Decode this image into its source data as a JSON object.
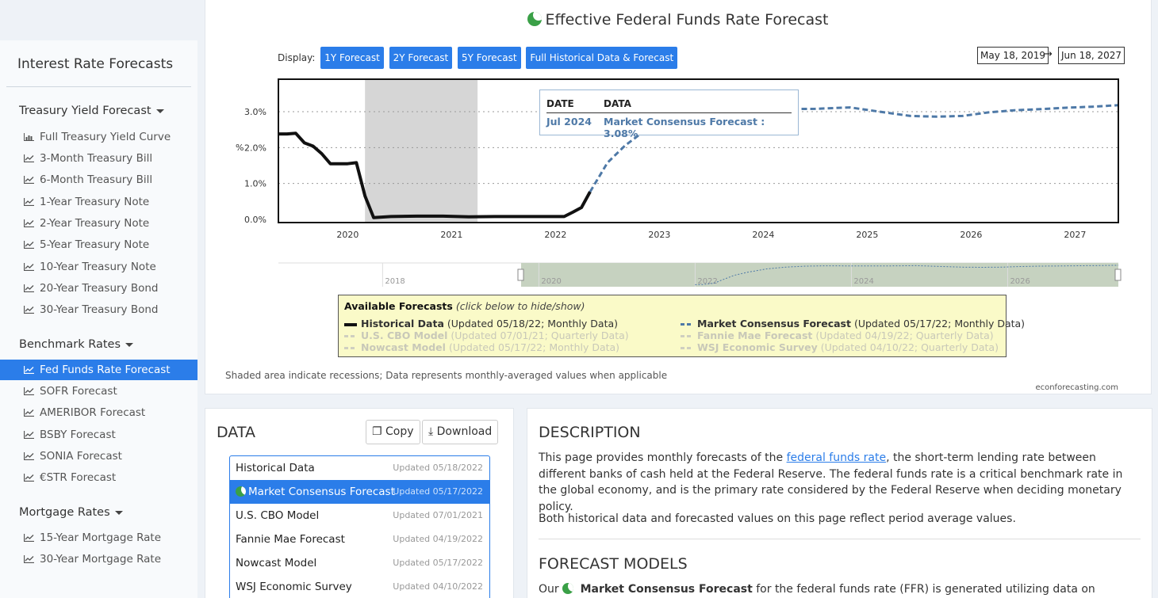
{
  "sidebar": {
    "title": "Interest Rate Forecasts",
    "groups": [
      {
        "label": "Treasury Yield Forecast",
        "items": [
          "Full Treasury Yield Curve",
          "3-Month Treasury Bill",
          "6-Month Treasury Bill",
          "1-Year Treasury Note",
          "2-Year Treasury Note",
          "5-Year Treasury Note",
          "10-Year Treasury Note",
          "20-Year Treasury Bond",
          "30-Year Treasury Bond"
        ]
      },
      {
        "label": "Benchmark Rates",
        "items": [
          "Fed Funds Rate Forecast",
          "SOFR Forecast",
          "AMERIBOR Forecast",
          "BSBY Forecast",
          "SONIA Forecast",
          "€STR Forecast"
        ]
      },
      {
        "label": "Mortgage Rates",
        "items": [
          "15-Year Mortgage Rate",
          "30-Year Mortgage Rate"
        ]
      }
    ],
    "active_item": "Fed Funds Rate Forecast"
  },
  "chart_panel": {
    "title": "Effective Federal Funds Rate Forecast",
    "display_label": "Display:",
    "range_buttons": [
      "1Y Forecast",
      "2Y Forecast",
      "5Y Forecast",
      "Full Historical Data & Forecast"
    ],
    "date_from": "May 18, 2019",
    "date_arrow": "→",
    "date_to": "Jun 18, 2027",
    "tooltip": {
      "date_header": "DATA",
      "date_col": "DATE",
      "date": "Jul 2024",
      "value": "Market Consensus Forecast : 3.08%"
    },
    "legend": {
      "title": "Available Forecasts",
      "hint": "(click below to hide/show)",
      "items": [
        {
          "name": "Historical Data",
          "detail": "(Updated 05/18/22; Monthly Data)",
          "active": true
        },
        {
          "name": "Market Consensus Forecast",
          "detail": "(Updated 05/17/22; Monthly Data)",
          "active": true
        },
        {
          "name": "U.S. CBO Model",
          "detail": "(Updated 07/01/21; Quarterly Data)",
          "active": false
        },
        {
          "name": "Fannie Mae Forecast",
          "detail": "(Updated 04/19/22; Quarterly Data)",
          "active": false
        },
        {
          "name": "Nowcast Model",
          "detail": "(Updated 05/17/22; Monthly Data)",
          "active": false
        },
        {
          "name": "WSJ Economic Survey",
          "detail": "(Updated 04/10/22; Quarterly Data)",
          "active": false
        }
      ]
    },
    "note": "Shaded area indicate recessions; Data represents monthly-averaged values when applicable",
    "brand": "econforecasting.com",
    "navigator_ticks": [
      "2018",
      "2020",
      "2022",
      "2024",
      "2026"
    ]
  },
  "chart_data": {
    "type": "line",
    "title": "Effective Federal Funds Rate Forecast",
    "ylabel": "%",
    "ylim": [
      0,
      3.3
    ],
    "y_ticks": [
      "0.0%",
      "1.0%",
      "2.0%",
      "3.0%"
    ],
    "x_ticks": [
      "2020",
      "2021",
      "2022",
      "2023",
      "2024",
      "2025",
      "2026",
      "2027"
    ],
    "xlim": [
      "2019-05",
      "2027-06"
    ],
    "recession": [
      "2020-03",
      "2021-04"
    ],
    "grid": true,
    "series": [
      {
        "name": "Historical Data",
        "style": "solid",
        "color": "#111111",
        "x": [
          "2019-05",
          "2019-06",
          "2019-07",
          "2019-08",
          "2019-09",
          "2019-10",
          "2019-11",
          "2019-12",
          "2020-01",
          "2020-02",
          "2020-03",
          "2020-04",
          "2020-06",
          "2020-09",
          "2020-12",
          "2021-03",
          "2021-06",
          "2021-09",
          "2021-12",
          "2022-01",
          "2022-02",
          "2022-03",
          "2022-04",
          "2022-05"
        ],
        "y": [
          2.38,
          2.38,
          2.4,
          2.13,
          2.04,
          1.83,
          1.55,
          1.55,
          1.55,
          1.58,
          0.65,
          0.05,
          0.08,
          0.09,
          0.09,
          0.07,
          0.08,
          0.08,
          0.08,
          0.08,
          0.08,
          0.2,
          0.33,
          0.77
        ]
      },
      {
        "name": "Market Consensus Forecast",
        "style": "dashed",
        "color": "#4e79a7",
        "x": [
          "2022-05",
          "2022-07",
          "2022-09",
          "2022-12",
          "2023-03",
          "2023-06",
          "2023-09",
          "2023-12",
          "2024-03",
          "2024-07",
          "2024-11",
          "2025-03",
          "2025-06",
          "2025-09",
          "2025-12",
          "2026-03",
          "2026-06",
          "2026-09",
          "2026-12",
          "2027-03",
          "2027-06"
        ],
        "y": [
          0.77,
          1.58,
          2.05,
          2.6,
          2.9,
          3.05,
          3.1,
          3.08,
          3.07,
          3.08,
          3.12,
          2.98,
          2.88,
          2.86,
          2.88,
          2.98,
          3.04,
          3.07,
          3.11,
          3.14,
          3.18
        ]
      }
    ]
  },
  "data_panel": {
    "title": "DATA",
    "copy_label": "Copy",
    "download_label": "Download",
    "rows": [
      {
        "name": "Historical Data",
        "updated": "Updated 05/18/2022",
        "selected": false
      },
      {
        "name": "Market Consensus Forecast",
        "updated": "Updated 05/17/2022",
        "selected": true
      },
      {
        "name": "U.S. CBO Model",
        "updated": "Updated 07/01/2021",
        "selected": false
      },
      {
        "name": "Fannie Mae Forecast",
        "updated": "Updated 04/19/2022",
        "selected": false
      },
      {
        "name": "Nowcast Model",
        "updated": "Updated 05/17/2022",
        "selected": false
      },
      {
        "name": "WSJ Economic Survey",
        "updated": "Updated 04/10/2022",
        "selected": false
      }
    ]
  },
  "description": {
    "title": "DESCRIPTION",
    "p1_before": "This page provides monthly forecasts of the ",
    "p1_link": "federal funds rate",
    "p1_after": ", the short-term lending rate between different banks of cash held at the Federal Reserve. The federal funds rate is a critical benchmark rate in the global economy, and is the primary rate considered by the Federal Reserve when deciding monetary policy.",
    "p2": "Both historical data and forecasted values on this page reflect period average values.",
    "models_title": "FORECAST MODELS",
    "p3_before": "Our ",
    "p3_bold": "Market Consensus Forecast",
    "p3_after": " for the federal funds rate (FFR) is generated utilizing data on"
  }
}
